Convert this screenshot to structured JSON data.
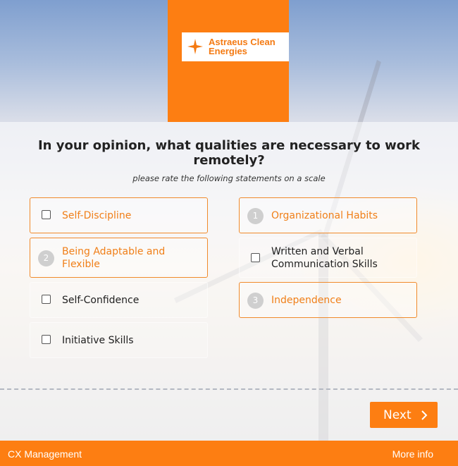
{
  "brand": {
    "name_line1": "Astraeus Clean",
    "name_line2": "Energies",
    "logo_icon": "starburst-icon",
    "accent_color": "#fd7e12"
  },
  "survey": {
    "question": "In your opinion, what qualities are necessary to work remotely?",
    "instruction": "please rate the following statements on a scale",
    "options": [
      {
        "label": "Self-Discipline",
        "selected": true,
        "rank": null
      },
      {
        "label": "Organizational Habits",
        "selected": true,
        "rank": "1"
      },
      {
        "label": "Being Adaptable and Flexible",
        "selected": true,
        "rank": "2"
      },
      {
        "label": "Written and Verbal Communication Skills",
        "selected": false,
        "rank": null
      },
      {
        "label": "Self-Confidence",
        "selected": false,
        "rank": null
      },
      {
        "label": "Independence",
        "selected": true,
        "rank": "3"
      },
      {
        "label": "Initiative Skills",
        "selected": false,
        "rank": null
      }
    ]
  },
  "navigation": {
    "next_label": "Next",
    "next_icon": "chevron-right-icon"
  },
  "footer": {
    "left_text": "CX Management",
    "right_text": "More info"
  }
}
